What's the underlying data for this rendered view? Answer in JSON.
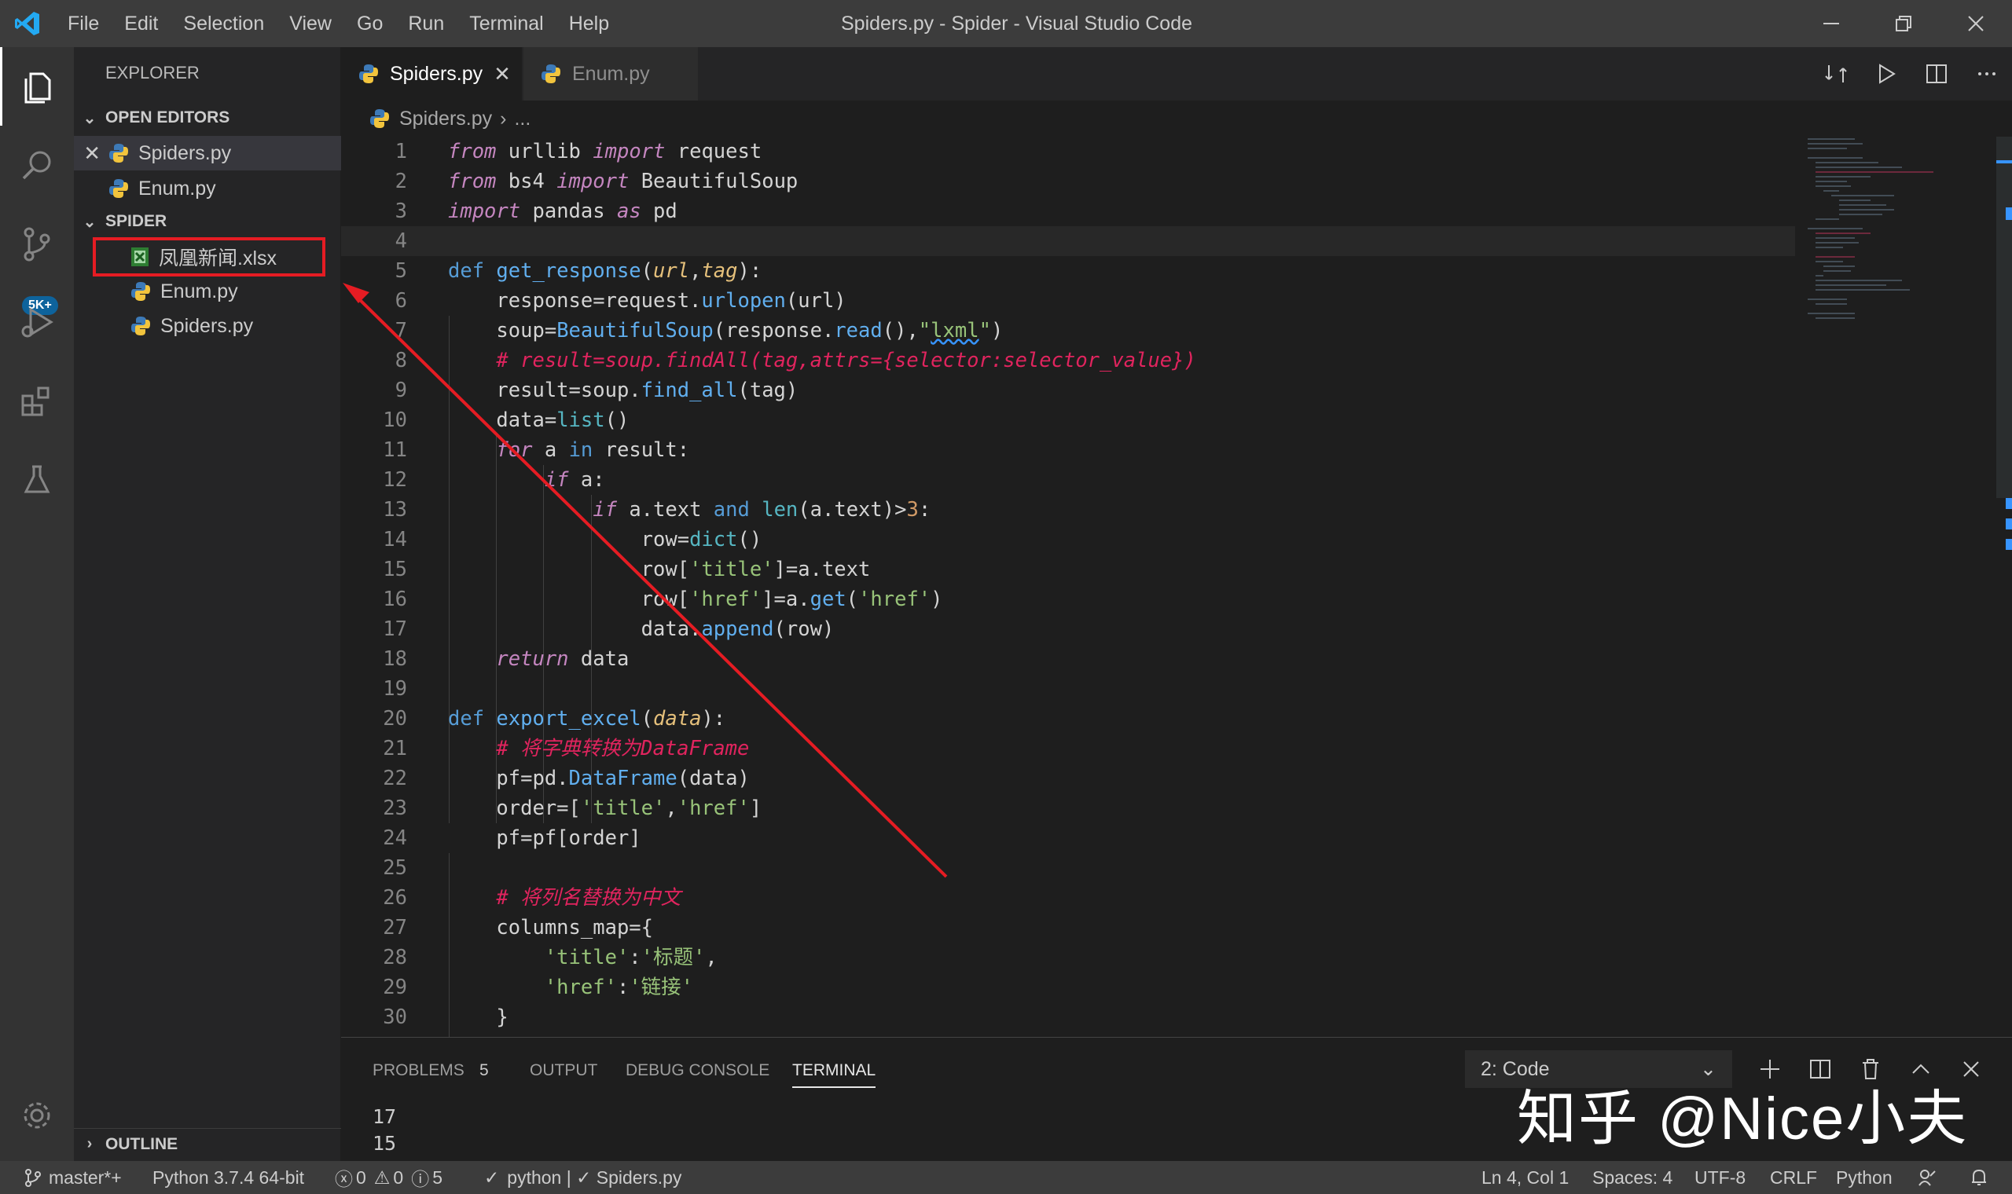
{
  "titlebar": {
    "menus": [
      "File",
      "Edit",
      "Selection",
      "View",
      "Go",
      "Run",
      "Terminal",
      "Help"
    ],
    "window_title": "Spiders.py - Spider - Visual Studio Code"
  },
  "activity": {
    "badge": "5K+"
  },
  "sidebar": {
    "title": "EXPLORER",
    "open_editors_label": "OPEN EDITORS",
    "open_editors": [
      "Spiders.py",
      "Enum.py"
    ],
    "folder_label": "SPIDER",
    "files": [
      "凤凰新闻.xlsx",
      "Enum.py",
      "Spiders.py"
    ],
    "outline_label": "OUTLINE"
  },
  "tabs": [
    {
      "label": "Spiders.py",
      "active": true
    },
    {
      "label": "Enum.py",
      "active": false
    }
  ],
  "breadcrumb": {
    "file": "Spiders.py",
    "sep": "›",
    "more": "..."
  },
  "code": {
    "language": "python",
    "line_numbers": [
      "1",
      "2",
      "3",
      "4",
      "5",
      "6",
      "7",
      "8",
      "9",
      "10",
      "11",
      "12",
      "13",
      "14",
      "15",
      "16",
      "17",
      "18",
      "19",
      "20",
      "21",
      "22",
      "23",
      "24",
      "25",
      "26",
      "27",
      "28",
      "29",
      "30"
    ]
  },
  "panel": {
    "tabs": [
      "PROBLEMS",
      "OUTPUT",
      "DEBUG CONSOLE",
      "TERMINAL"
    ],
    "problems_count": "5",
    "terminal_select": "2: Code",
    "terminal_lines": [
      "17",
      "15"
    ]
  },
  "watermark": "知乎 @Nice小夫",
  "statusbar": {
    "branch": "master*+",
    "interpreter": "Python 3.7.4 64-bit",
    "errors": "0",
    "warnings": "0",
    "infos": "5",
    "task": "python | ✓ Spiders.py",
    "position": "Ln 4, Col 1",
    "spaces": "Spaces: 4",
    "encoding": "UTF-8",
    "eol": "CRLF",
    "mode": "Python"
  },
  "colors": {
    "accent_blue": "#007acc",
    "annotation_red": "#e51c23",
    "excel_green": "#6a9955"
  }
}
